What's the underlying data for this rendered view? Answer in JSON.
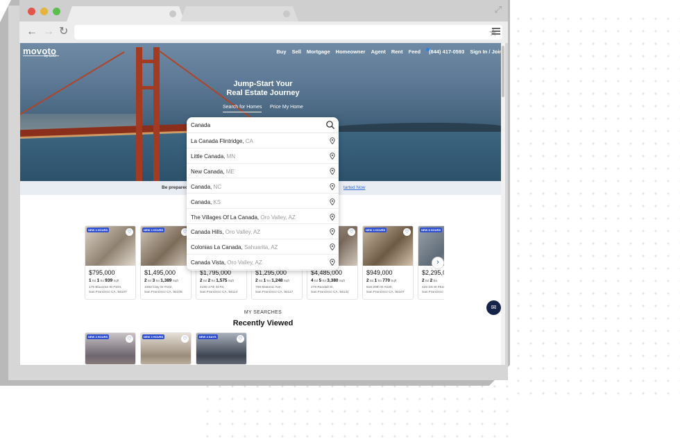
{
  "site": {
    "logo": "movoto",
    "logo_sub": "by OJO",
    "nav": [
      "Buy",
      "Sell",
      "Mortgage",
      "Homeowner",
      "Agent",
      "Rent",
      "Feed",
      "(844) 417-0593",
      "Sign In / Join"
    ]
  },
  "hero": {
    "headline_line1": "Jump-Start Your",
    "headline_line2": "Real Estate Journey",
    "tab_search": "Search for Homes",
    "tab_price": "Price My Home"
  },
  "search": {
    "query": "Canada",
    "suggestions": [
      {
        "name": "La Canada Flintridge,",
        "region": " CA"
      },
      {
        "name": "Little Canada,",
        "region": " MN"
      },
      {
        "name": "New Canada,",
        "region": " ME"
      },
      {
        "name": "Canada,",
        "region": " NC"
      },
      {
        "name": "Canada,",
        "region": " KS"
      },
      {
        "name": "The Villages Of La Canada,",
        "region": " Oro Valley, AZ"
      },
      {
        "name": "Canada Hills,",
        "region": " Oro Valley, AZ"
      },
      {
        "name": "Colonias La Canada,",
        "region": " Sahuarita, AZ"
      },
      {
        "name": "Canada Vista,",
        "region": " Oro Valley, AZ"
      }
    ]
  },
  "banner": {
    "text": "Be prepared",
    "link": "tarted Now"
  },
  "listings": [
    {
      "badge": "NEW 4 HOURS",
      "price": "$795,000",
      "beds": "1",
      "baths": "1",
      "sqft": "939",
      "addr1": "175 Bluxome St #104,",
      "addr2": "San Francisco CA, 94107"
    },
    {
      "badge": "NEW 4 HOURS",
      "price": "$1,495,000",
      "beds": "2",
      "baths": "3",
      "sqft": "1,389",
      "addr1": "1083 Clay St #102,",
      "addr2": "San Francisco CA, 94108"
    },
    {
      "badge": "",
      "price": "$1,795,000",
      "beds": "2",
      "baths": "2",
      "sqft": "1,575",
      "addr1": "4150 17th St #3,",
      "addr2": "San Francisco CA, 94114"
    },
    {
      "badge": "",
      "price": "$1,295,000",
      "beds": "2",
      "baths": "1",
      "sqft": "1,248",
      "addr1": "708 Masonic Ave,",
      "addr2": "San Francisco CA, 94117"
    },
    {
      "badge": "",
      "price": "$4,485,000",
      "beds": "4",
      "baths": "5",
      "sqft": "3,380",
      "addr1": "278 Randall St,",
      "addr2": "San Francisco CA, 94131"
    },
    {
      "badge": "NEW 4 HOURS",
      "price": "$949,000",
      "beds": "2",
      "baths": "1",
      "sqft": "770",
      "addr1": "616 20th St #220,",
      "addr2": "San Francisco CA, 94107"
    },
    {
      "badge": "NEW 8 HOURS",
      "price": "$2,295,0",
      "beds": "2",
      "baths": "2",
      "sqft": "",
      "addr1": "425 1st St #510,",
      "addr2": "San Francisco"
    }
  ],
  "labels": {
    "bd": "Bd",
    "ba": "Ba",
    "sqft": "Sqft"
  },
  "my_searches": {
    "label": "MY SEARCHES",
    "title": "Recently Viewed",
    "badges": [
      "NEW 4 HOURS",
      "NEW 4 HOURS",
      "NEW 4 DAYS"
    ]
  },
  "colors": {
    "accent": "#2f4fd0",
    "chat": "#16244a",
    "link": "#2d6bd0"
  },
  "icons": [
    "search-icon",
    "heart-icon",
    "location-pin-icon",
    "chevron-right-icon",
    "chat-icon",
    "star-icon",
    "menu-icon"
  ]
}
